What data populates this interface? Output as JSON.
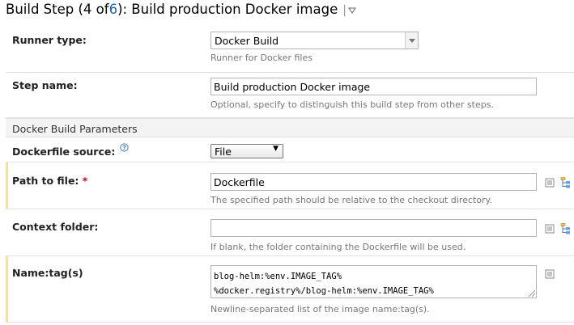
{
  "header": {
    "prefix": "Build Step (4 of ",
    "total": "6",
    "suffix": "): Build production Docker image"
  },
  "runner_type": {
    "label": "Runner type:",
    "value": "Docker Build",
    "hint": "Runner for Docker files"
  },
  "step_name": {
    "label": "Step name:",
    "value": "Build production Docker image",
    "hint": "Optional, specify to distinguish this build step from other steps."
  },
  "section": {
    "title": "Docker Build Parameters"
  },
  "dockerfile_source": {
    "label": "Dockerfile source:",
    "value": "File",
    "help_icon": "help-icon"
  },
  "path_to_file": {
    "label": "Path to file:",
    "required_mark": "*",
    "value": "Dockerfile",
    "hint": "The specified path should be relative to the checkout directory."
  },
  "context_folder": {
    "label": "Context folder:",
    "value": "",
    "hint": "If blank, the folder containing the Dockerfile will be used."
  },
  "name_tags": {
    "label": "Name:tag(s)",
    "lines": [
      "blog-helm:%env.IMAGE_TAG%",
      "%docker.registry%/blog-helm:%env.IMAGE_TAG%"
    ],
    "hint": "Newline-separated list of the image name:tag(s)."
  },
  "colors": {
    "link": "#1764b6",
    "required": "#d0021b",
    "marker": "#f6e199"
  }
}
